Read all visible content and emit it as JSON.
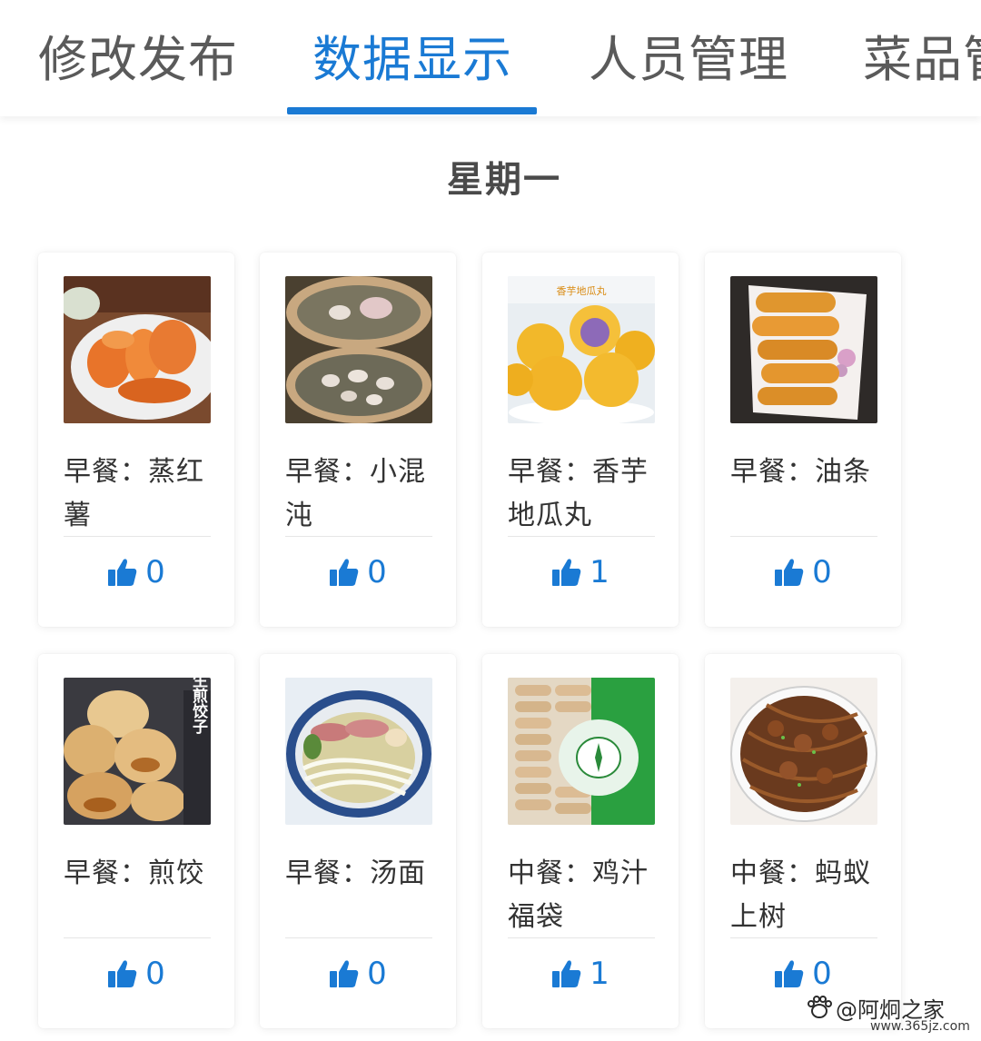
{
  "tabs": [
    {
      "label": "修改发布",
      "active": false
    },
    {
      "label": "数据显示",
      "active": true
    },
    {
      "label": "人员管理",
      "active": false
    },
    {
      "label": "菜品管",
      "active": false
    }
  ],
  "day_title": "星期一",
  "cards": [
    {
      "dish": "早餐：蒸红薯",
      "likes": "0"
    },
    {
      "dish": "早餐：小混沌",
      "likes": "0"
    },
    {
      "dish": "早餐：香芋地瓜丸",
      "likes": "1"
    },
    {
      "dish": "早餐：油条",
      "likes": "0"
    },
    {
      "dish": "早餐：煎饺",
      "likes": "0"
    },
    {
      "dish": "早餐：汤面",
      "likes": "0"
    },
    {
      "dish": "中餐：鸡汁福袋",
      "likes": "1"
    },
    {
      "dish": "中餐：蚂蚁上树",
      "likes": "0"
    }
  ],
  "image_text": {
    "ball_label": "香芋地瓜丸",
    "dumpling_label": "生煎饺子"
  },
  "watermark": {
    "text": "@阿炯之家",
    "site": "www.365jz.com"
  },
  "colors": {
    "accent": "#1a7ad4",
    "text": "#333333",
    "tab_inactive": "#5a5a5a"
  },
  "icons": {
    "like": "thumbs-up-icon",
    "watermark": "paw-icon"
  }
}
